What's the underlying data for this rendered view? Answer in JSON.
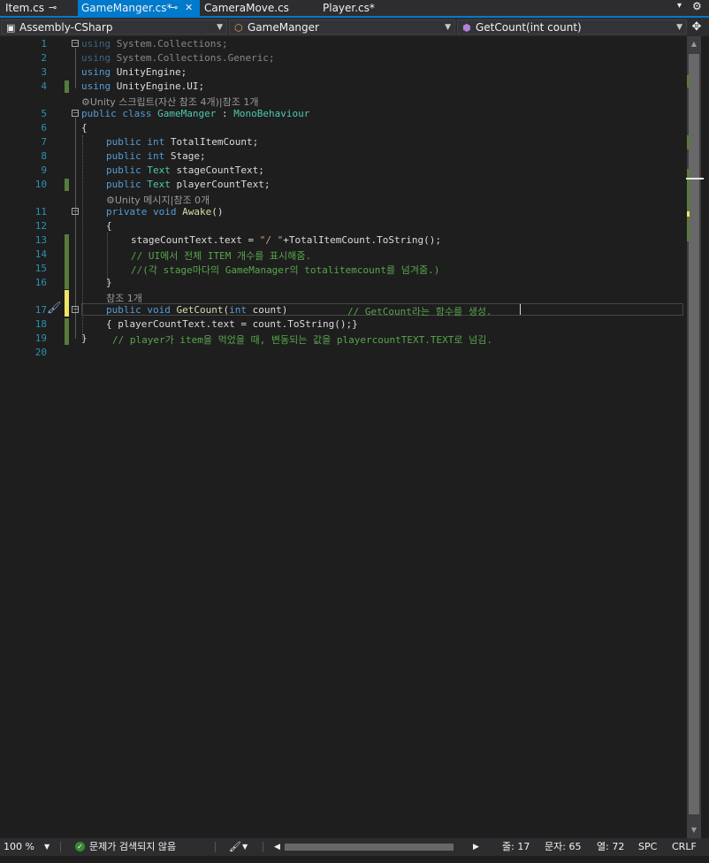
{
  "tabs": [
    {
      "label": "Item.cs",
      "pinned": true
    },
    {
      "label": "GameManger.cs*",
      "active": true,
      "pinned": true
    },
    {
      "label": "CameraMove.cs"
    },
    {
      "label": "Player.cs*"
    }
  ],
  "tab_icons": {
    "pin": "⊸",
    "pin_active": "⊸",
    "close": "✕",
    "dropdown": "▾",
    "settings": "⚙"
  },
  "navbar": {
    "project": "Assembly-CSharp",
    "type": "GameManger",
    "member": "GetCount(int count)"
  },
  "codelens": {
    "line4_5": "⚙Unity 스크립트(자산 참조 4개)|참조 1개",
    "line10_11": "⚙Unity 메시지|참조 0개",
    "line16_17": "참조 1개"
  },
  "code": {
    "l1": {
      "kw": "using",
      "rest": " System.Collections;"
    },
    "l2": {
      "kw": "using",
      "rest": " System.Collections.Generic;"
    },
    "l3": {
      "kw": "using",
      "rest": " UnityEngine;"
    },
    "l4": {
      "kw": "using",
      "rest": " UnityEngine.UI;"
    },
    "l5": {
      "kw": "public class",
      "ty": "GameManger",
      "sep": " : ",
      "base": "MonoBehaviour"
    },
    "l6": "{",
    "l7": {
      "kw": "public int",
      "rest": " TotalItemCount;"
    },
    "l8": {
      "kw": "public int",
      "rest": " Stage;"
    },
    "l9": {
      "kw": "public",
      "ty": "Text",
      "rest": " stageCountText;"
    },
    "l10": {
      "kw": "public",
      "ty": "Text",
      "rest": " playerCountText;"
    },
    "l11": {
      "kw": "private void",
      "meth": "Awake",
      "rest": "()"
    },
    "l12": "{",
    "l13": {
      "a": "stageCountText.text = ",
      "str": "\"/ \"",
      "b": "+TotalItemCount.ToString();"
    },
    "l14": "// UI에서 전체 ITEM 개수를 표시해줌.",
    "l15": "//(각 stage마다의 GameManager의 totalitemcount를 넘겨줌.)",
    "l16": "}",
    "l17": {
      "kw": "public void",
      "meth": "GetCount",
      "p1": "(",
      "pkw": "int",
      "p2": " count)",
      "cm": "// GetCount라는 함수를 생성."
    },
    "l18": "{ playerCountText.text = count.ToString();}",
    "l19": {
      "brace": "}",
      "cm": "// player가 item을 먹었을 때, 변동되는 값을 playercountTEXT.TEXT로 넘김."
    }
  },
  "line_numbers": [
    "1",
    "2",
    "3",
    "4",
    "5",
    "6",
    "7",
    "8",
    "9",
    "10",
    "11",
    "12",
    "13",
    "14",
    "15",
    "16",
    "17",
    "18",
    "19",
    "20"
  ],
  "status": {
    "zoom": "100 %",
    "issues": "문제가 검색되지 않음",
    "line": "줄: 17",
    "char": "문자: 65",
    "col": "열: 72",
    "spacing": "SPC",
    "eol": "CRLF"
  },
  "colors": {
    "accent": "#007acc",
    "keyword": "#569cd6",
    "type": "#4ec9b0",
    "comment": "#57a64a",
    "string": "#d69d85",
    "method": "#dcdcaa",
    "saved_change": "#577b3d",
    "unsaved_change": "#efe36a"
  }
}
